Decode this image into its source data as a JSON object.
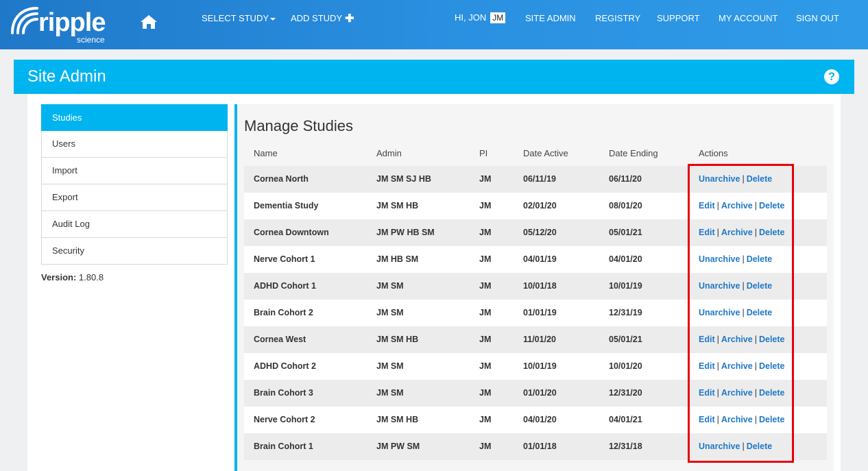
{
  "nav": {
    "logo_word": "ripple",
    "logo_sub": "science",
    "select_study": "SELECT STUDY",
    "add_study": "ADD STUDY",
    "greeting": "HI, JON",
    "initials": "JM",
    "site_admin": "SITE ADMIN",
    "registry": "REGISTRY",
    "support": "SUPPORT",
    "my_account": "MY ACCOUNT",
    "sign_out": "SIGN OUT"
  },
  "header": {
    "title": "Site Admin",
    "help": "?"
  },
  "sidebar": {
    "items": [
      {
        "label": "Studies",
        "active": true
      },
      {
        "label": "Users"
      },
      {
        "label": "Import"
      },
      {
        "label": "Export"
      },
      {
        "label": "Audit Log"
      },
      {
        "label": "Security"
      }
    ],
    "version_label": "Version:",
    "version_value": "1.80.8"
  },
  "main": {
    "title": "Manage Studies",
    "columns": [
      "Name",
      "Admin",
      "PI",
      "Date Active",
      "Date Ending",
      "Actions"
    ],
    "rows": [
      {
        "name": "Cornea North",
        "admin": "JM SM SJ HB",
        "pi": "JM",
        "active": "06/11/19",
        "ending": "06/11/20",
        "actions": [
          "Unarchive",
          "Delete"
        ]
      },
      {
        "name": "Dementia Study",
        "admin": "JM SM HB",
        "pi": "JM",
        "active": "02/01/20",
        "ending": "08/01/20",
        "actions": [
          "Edit",
          "Archive",
          "Delete"
        ]
      },
      {
        "name": "Cornea Downtown",
        "admin": "JM PW HB SM",
        "pi": "JM",
        "active": "05/12/20",
        "ending": "05/01/21",
        "actions": [
          "Edit",
          "Archive",
          "Delete"
        ]
      },
      {
        "name": "Nerve Cohort 1",
        "admin": "JM HB SM",
        "pi": "JM",
        "active": "04/01/19",
        "ending": "04/01/20",
        "actions": [
          "Unarchive",
          "Delete"
        ]
      },
      {
        "name": "ADHD Cohort 1",
        "admin": "JM SM",
        "pi": "JM",
        "active": "10/01/18",
        "ending": "10/01/19",
        "actions": [
          "Unarchive",
          "Delete"
        ]
      },
      {
        "name": "Brain Cohort 2",
        "admin": "JM SM",
        "pi": "JM",
        "active": "01/01/19",
        "ending": "12/31/19",
        "actions": [
          "Unarchive",
          "Delete"
        ]
      },
      {
        "name": "Cornea West",
        "admin": "JM SM HB",
        "pi": "JM",
        "active": "11/01/20",
        "ending": "05/01/21",
        "actions": [
          "Edit",
          "Archive",
          "Delete"
        ]
      },
      {
        "name": "ADHD Cohort 2",
        "admin": "JM SM",
        "pi": "JM",
        "active": "10/01/19",
        "ending": "10/01/20",
        "actions": [
          "Edit",
          "Archive",
          "Delete"
        ]
      },
      {
        "name": "Brain Cohort 3",
        "admin": "JM SM",
        "pi": "JM",
        "active": "01/01/20",
        "ending": "12/31/20",
        "actions": [
          "Edit",
          "Archive",
          "Delete"
        ]
      },
      {
        "name": "Nerve Cohort 2",
        "admin": "JM SM HB",
        "pi": "JM",
        "active": "04/01/20",
        "ending": "04/01/21",
        "actions": [
          "Edit",
          "Archive",
          "Delete"
        ]
      },
      {
        "name": "Brain Cohort 1",
        "admin": "JM PW SM",
        "pi": "JM",
        "active": "01/01/18",
        "ending": "12/31/18",
        "actions": [
          "Unarchive",
          "Delete"
        ]
      }
    ]
  },
  "colors": {
    "nav_start": "#1f78c8",
    "accent": "#00b4ef",
    "link": "#1f78c8",
    "highlight": "#e8000b"
  }
}
